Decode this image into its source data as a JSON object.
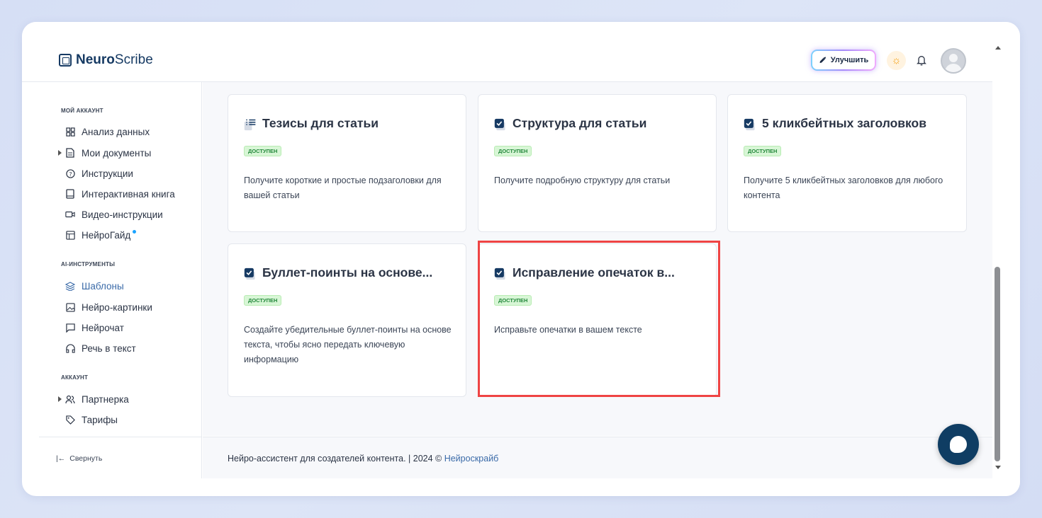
{
  "header": {
    "logo_bold": "Neuro",
    "logo_light": "Scribe",
    "upgrade_label": "Улучшить"
  },
  "sidebar": {
    "sections": [
      {
        "title": "МОЙ АККАУНТ"
      },
      {
        "title": "AI-ИНСТРУМЕНТЫ"
      },
      {
        "title": "АККАУНТ"
      }
    ],
    "items": [
      {
        "label": "Анализ данных",
        "icon": "grid-icon"
      },
      {
        "label": "Мои документы",
        "icon": "document-icon"
      },
      {
        "label": "Инструкции",
        "icon": "question-icon"
      },
      {
        "label": "Интерактивная книга",
        "icon": "book-icon"
      },
      {
        "label": "Видео-инструкции",
        "icon": "video-icon"
      },
      {
        "label": "НейроГайд",
        "icon": "layout-icon"
      },
      {
        "label": "Шаблоны",
        "icon": "layers-icon"
      },
      {
        "label": "Нейро-картинки",
        "icon": "image-icon"
      },
      {
        "label": "Нейрочат",
        "icon": "chat-icon"
      },
      {
        "label": "Речь в текст",
        "icon": "headphones-icon"
      },
      {
        "label": "Партнерка",
        "icon": "users-icon"
      },
      {
        "label": "Тарифы",
        "icon": "tag-icon"
      }
    ],
    "collapse_label": "Свернуть"
  },
  "cards": [
    {
      "title": "Тезисы для статьи",
      "badge": "доступен",
      "desc": "Получите короткие и простые подзаголовки для вашей статьи",
      "icon": "list-icon"
    },
    {
      "title": "Структура для статьи",
      "badge": "доступен",
      "desc": "Получите подробную структуру для статьи",
      "icon": "checkbox-icon"
    },
    {
      "title": "5 кликбейтных заголовков",
      "badge": "доступен",
      "desc": "Получите 5 кликбейтных заголовков для любого контента",
      "icon": "checkbox-icon"
    },
    {
      "title": "Буллет-поинты на основе...",
      "badge": "доступен",
      "desc": "Создайте убедительные буллет-поинты на основе текста, чтобы ясно передать ключевую информацию",
      "icon": "checkbox-icon"
    },
    {
      "title": "Исправление опечаток в...",
      "badge": "доступен",
      "desc": "Исправьте опечатки в вашем тексте",
      "icon": "checkbox-icon"
    }
  ],
  "footer": {
    "text": "Нейро-ассистент для создателей контента.  | 2024 © ",
    "link": "Нейроскрайб"
  },
  "colors": {
    "brand": "#163a63",
    "accent": "#3a6aa8",
    "badge_bg": "#d8f6d6",
    "badge_text": "#22883a",
    "highlight": "#ef4444",
    "chat_button": "#0f3d63"
  }
}
